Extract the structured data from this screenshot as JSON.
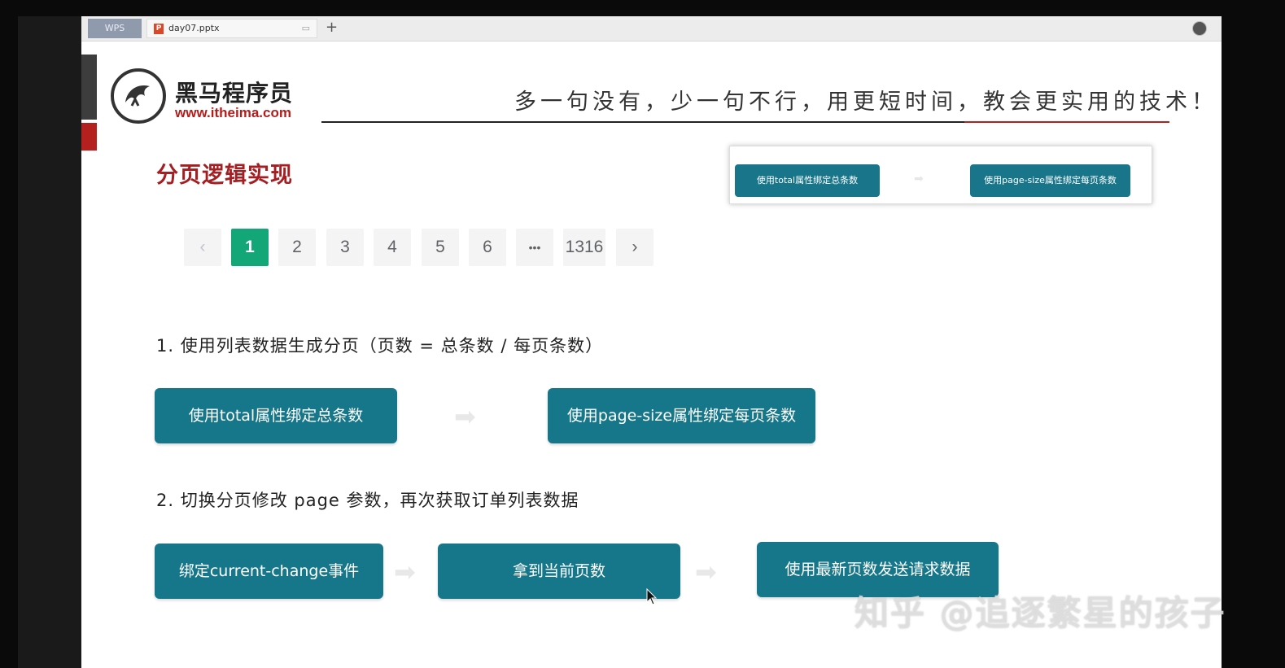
{
  "tabs": {
    "app_tab": "WPS",
    "file_tab": "day07.pptx",
    "new_tab": "+"
  },
  "header": {
    "logo_text": "黑马程序员",
    "logo_url": "www.itheima.com",
    "slogan": "多一句没有，少一句不行，用更短时间，教会更实用的技术！"
  },
  "slide": {
    "title": "分页逻辑实现",
    "mini_panel": {
      "btn1": "使用total属性绑定总条数",
      "btn2": "使用page-size属性绑定每页条数"
    },
    "pager": {
      "prev": "‹",
      "pages": [
        "1",
        "2",
        "3",
        "4",
        "5",
        "6"
      ],
      "ellipsis": "•••",
      "last": "1316",
      "next": "›",
      "current": 1
    },
    "step1": {
      "label": "1. 使用列表数据生成分页（页数 = 总条数 / 每页条数）",
      "btn1": "使用total属性绑定总条数",
      "btn2": "使用page-size属性绑定每页条数"
    },
    "step2": {
      "label": "2. 切换分页修改 page 参数，再次获取订单列表数据",
      "btn1": "绑定current-change事件",
      "btn2": "拿到当前页数",
      "btn3": "使用最新页数发送请求数据"
    }
  },
  "watermark": "知乎 @追逐繁星的孩子",
  "colors": {
    "teal": "#16778a",
    "active_page": "#13a676",
    "title_red": "#a41e22"
  }
}
